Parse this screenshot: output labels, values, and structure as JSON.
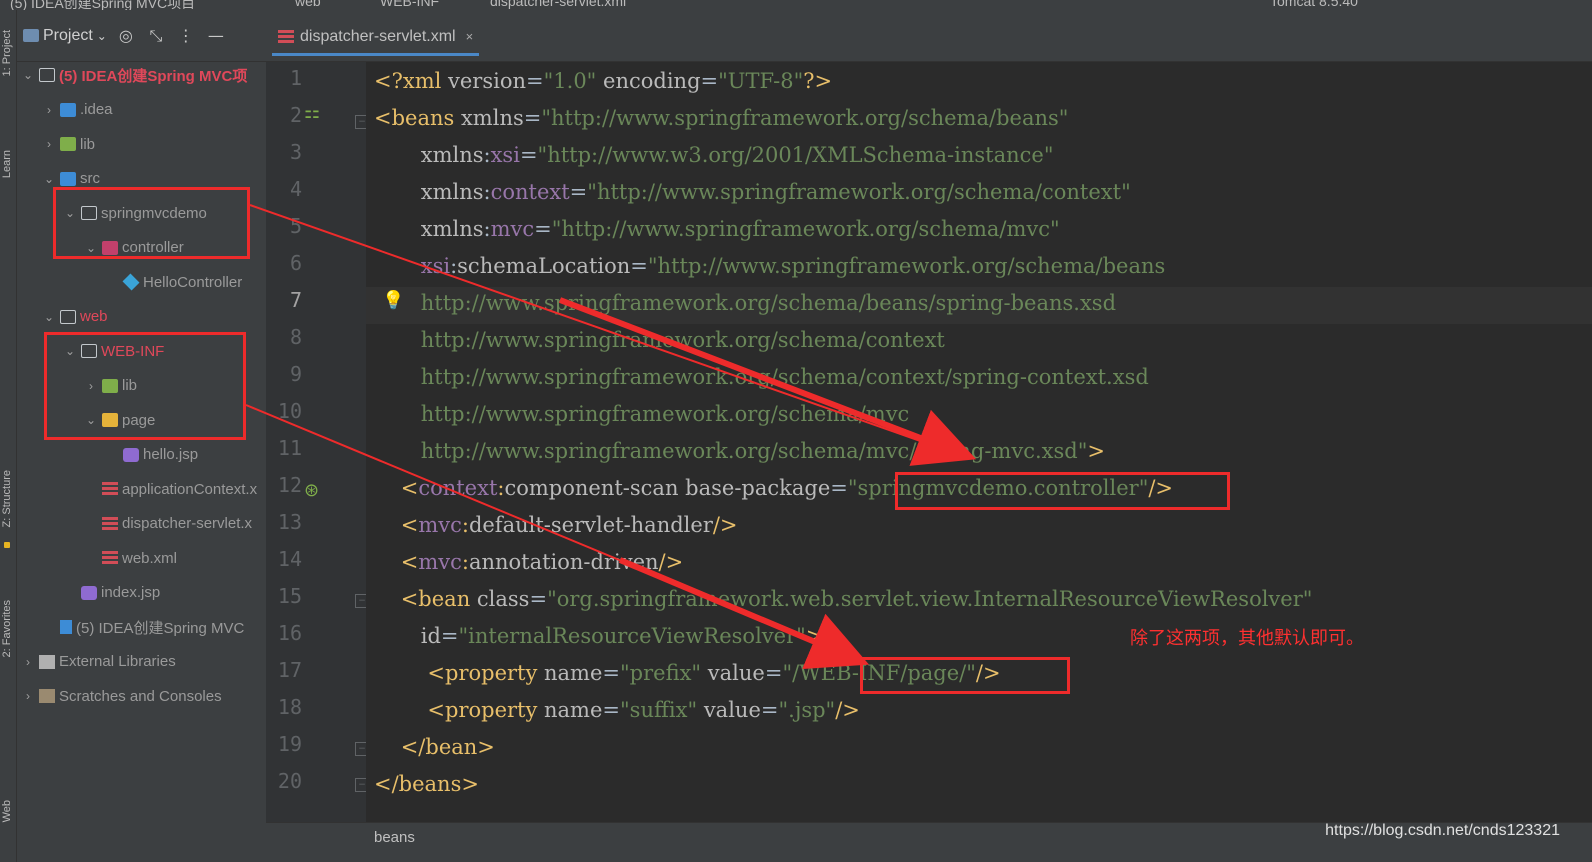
{
  "window": {
    "breadcrumb": [
      "(5) IDEA创建Spring MVC项目",
      "web",
      "WEB-INF",
      "dispatcher-servlet.xml"
    ],
    "run_config": "Tomcat 8.5.40"
  },
  "project_panel": {
    "title": "Project",
    "icons": [
      "target-icon",
      "collapse-icon",
      "more-icon",
      "minimize-icon"
    ],
    "tree": [
      {
        "label": "(5)  IDEA创建Spring MVC项",
        "depth": 0,
        "expanded": true,
        "icon": "folder",
        "style": "red-bold"
      },
      {
        "label": ".idea",
        "depth": 1,
        "expanded": false,
        "icon": "folder-blue",
        "style": "grey"
      },
      {
        "label": "lib",
        "depth": 1,
        "expanded": false,
        "icon": "folder-green",
        "style": "grey"
      },
      {
        "label": "src",
        "depth": 1,
        "expanded": true,
        "icon": "folder-blue",
        "style": "grey"
      },
      {
        "label": "springmvcdemo",
        "depth": 2,
        "expanded": true,
        "icon": "folder",
        "style": "grey"
      },
      {
        "label": "controller",
        "depth": 3,
        "expanded": true,
        "icon": "folder-pink",
        "style": "grey"
      },
      {
        "label": "HelloController",
        "depth": 4,
        "expanded": null,
        "icon": "class",
        "style": "grey"
      },
      {
        "label": "web",
        "depth": 1,
        "expanded": true,
        "icon": "folder",
        "style": "red"
      },
      {
        "label": "WEB-INF",
        "depth": 2,
        "expanded": true,
        "icon": "folder",
        "style": "red"
      },
      {
        "label": "lib",
        "depth": 3,
        "expanded": false,
        "icon": "folder-green",
        "style": "grey"
      },
      {
        "label": "page",
        "depth": 3,
        "expanded": true,
        "icon": "folder-yellow",
        "style": "grey"
      },
      {
        "label": "hello.jsp",
        "depth": 4,
        "expanded": null,
        "icon": "jsp",
        "style": "grey"
      },
      {
        "label": "applicationContext.x",
        "depth": 3,
        "expanded": null,
        "icon": "xml",
        "style": "grey"
      },
      {
        "label": "dispatcher-servlet.x",
        "depth": 3,
        "expanded": null,
        "icon": "xml",
        "style": "grey"
      },
      {
        "label": "web.xml",
        "depth": 3,
        "expanded": null,
        "icon": "xml",
        "style": "grey"
      },
      {
        "label": "index.jsp",
        "depth": 2,
        "expanded": null,
        "icon": "jsp",
        "style": "grey"
      },
      {
        "label": "(5)  IDEA创建Spring MVC",
        "depth": 1,
        "expanded": null,
        "icon": "iml",
        "style": "grey"
      },
      {
        "label": "External Libraries",
        "depth": 0,
        "expanded": false,
        "icon": "libraries",
        "style": "grey"
      },
      {
        "label": "Scratches and Consoles",
        "depth": 0,
        "expanded": false,
        "icon": "scratches",
        "style": "grey"
      }
    ]
  },
  "left_stripe": [
    "1: Project",
    "Learn",
    "Z: Structure",
    "2: Favorites",
    "Web"
  ],
  "editor": {
    "tab_label": "dispatcher-servlet.xml",
    "tab_close": "×",
    "line_numbers": [
      "1",
      "2",
      "3",
      "4",
      "5",
      "6",
      "7",
      "8",
      "9",
      "10",
      "11",
      "12",
      "13",
      "14",
      "15",
      "16",
      "17",
      "18",
      "19",
      "20"
    ],
    "current_line": "7",
    "lines": [
      [
        [
          "t-prolog",
          "<?xml "
        ],
        [
          "t-attr",
          "version"
        ],
        [
          "t-plain",
          "="
        ],
        [
          "t-val",
          "\"1.0\""
        ],
        [
          "t-plain",
          " "
        ],
        [
          "t-attr",
          "encoding"
        ],
        [
          "t-plain",
          "="
        ],
        [
          "t-val",
          "\"UTF-8\""
        ],
        [
          "t-prolog",
          "?>"
        ]
      ],
      [
        [
          "t-tag",
          "<beans "
        ],
        [
          "t-attr",
          "xmlns"
        ],
        [
          "t-plain",
          "="
        ],
        [
          "t-val",
          "\"http://www.springframework.org/schema/beans\""
        ]
      ],
      [
        [
          "t-plain",
          "       "
        ],
        [
          "t-attr",
          "xmlns"
        ],
        [
          "t-plain",
          ":"
        ],
        [
          "t-ns",
          "xsi"
        ],
        [
          "t-plain",
          "="
        ],
        [
          "t-val",
          "\"http://www.w3.org/2001/XMLSchema-instance\""
        ]
      ],
      [
        [
          "t-plain",
          "       "
        ],
        [
          "t-attr",
          "xmlns"
        ],
        [
          "t-plain",
          ":"
        ],
        [
          "t-ns",
          "context"
        ],
        [
          "t-plain",
          "="
        ],
        [
          "t-val",
          "\"http://www.springframework.org/schema/context\""
        ]
      ],
      [
        [
          "t-plain",
          "       "
        ],
        [
          "t-attr",
          "xmlns"
        ],
        [
          "t-plain",
          ":"
        ],
        [
          "t-ns",
          "mvc"
        ],
        [
          "t-plain",
          "="
        ],
        [
          "t-val",
          "\"http://www.springframework.org/schema/mvc\""
        ]
      ],
      [
        [
          "t-plain",
          "       "
        ],
        [
          "t-ns",
          "xsi"
        ],
        [
          "t-plain",
          ":"
        ],
        [
          "t-attr",
          "schemaLocation"
        ],
        [
          "t-plain",
          "="
        ],
        [
          "t-val",
          "\"http://www.springframework.org/schema/beans"
        ]
      ],
      [
        [
          "t-val",
          "       http://www.springframework.org/schema/beans/spring-beans.xsd"
        ]
      ],
      [
        [
          "t-val",
          "       http://www.springframework.org/schema/context"
        ]
      ],
      [
        [
          "t-val",
          "       http://www.springframework.org/schema/context/spring-context.xsd"
        ]
      ],
      [
        [
          "t-val",
          "       http://www.springframework.org/schema/mvc"
        ]
      ],
      [
        [
          "t-val",
          "       http://www.springframework.org/schema/mvc/spring-mvc.xsd\""
        ],
        [
          "t-tag",
          ">"
        ]
      ],
      [
        [
          "t-plain",
          "    "
        ],
        [
          "t-tag",
          "<"
        ],
        [
          "t-ns",
          "context"
        ],
        [
          "t-tag",
          ":"
        ],
        [
          "t-attr",
          "component-scan "
        ],
        [
          "t-attr",
          "base-package"
        ],
        [
          "t-plain",
          "="
        ],
        [
          "t-val",
          "\"springmvcdemo.controller\""
        ],
        [
          "t-tag",
          "/>"
        ]
      ],
      [
        [
          "t-plain",
          "    "
        ],
        [
          "t-tag",
          "<"
        ],
        [
          "t-ns",
          "mvc"
        ],
        [
          "t-tag",
          ":"
        ],
        [
          "t-attr",
          "default-servlet-handler"
        ],
        [
          "t-tag",
          "/>"
        ]
      ],
      [
        [
          "t-plain",
          "    "
        ],
        [
          "t-tag",
          "<"
        ],
        [
          "t-ns",
          "mvc"
        ],
        [
          "t-tag",
          ":"
        ],
        [
          "t-attr",
          "annotation-driven"
        ],
        [
          "t-tag",
          "/>"
        ]
      ],
      [
        [
          "t-plain",
          "    "
        ],
        [
          "t-tag",
          "<bean "
        ],
        [
          "t-attr",
          "class"
        ],
        [
          "t-plain",
          "="
        ],
        [
          "t-val",
          "\"org.springframework.web.servlet.view.InternalResourceViewResolver\""
        ]
      ],
      [
        [
          "t-plain",
          "       "
        ],
        [
          "t-attr",
          "id"
        ],
        [
          "t-plain",
          "="
        ],
        [
          "t-val",
          "\"internalResourceViewResolver\""
        ],
        [
          "t-tag",
          ">"
        ]
      ],
      [
        [
          "t-plain",
          "        "
        ],
        [
          "t-tag",
          "<property "
        ],
        [
          "t-attr",
          "name"
        ],
        [
          "t-plain",
          "="
        ],
        [
          "t-val",
          "\"prefix\""
        ],
        [
          "t-plain",
          " "
        ],
        [
          "t-attr",
          "value"
        ],
        [
          "t-plain",
          "="
        ],
        [
          "t-val",
          "\"/WEB-INF/page/\""
        ],
        [
          "t-tag",
          "/>"
        ]
      ],
      [
        [
          "t-plain",
          "        "
        ],
        [
          "t-tag",
          "<property "
        ],
        [
          "t-attr",
          "name"
        ],
        [
          "t-plain",
          "="
        ],
        [
          "t-val",
          "\"suffix\""
        ],
        [
          "t-plain",
          " "
        ],
        [
          "t-attr",
          "value"
        ],
        [
          "t-plain",
          "="
        ],
        [
          "t-val",
          "\".jsp\""
        ],
        [
          "t-tag",
          "/>"
        ]
      ],
      [
        [
          "t-plain",
          "    "
        ],
        [
          "t-tag",
          "</bean>"
        ]
      ],
      [
        [
          "t-tag",
          "</beans>"
        ]
      ]
    ]
  },
  "status": {
    "breadcrumb": "beans"
  },
  "annotation_note": "除了这两项，其他默认即可。",
  "watermark": "https://blog.csdn.net/cnds123321",
  "colors": {
    "annotation_red": "#ee2b2b",
    "tag": "#e8bf6a",
    "value": "#6a8759",
    "namespace": "#9876aa"
  }
}
